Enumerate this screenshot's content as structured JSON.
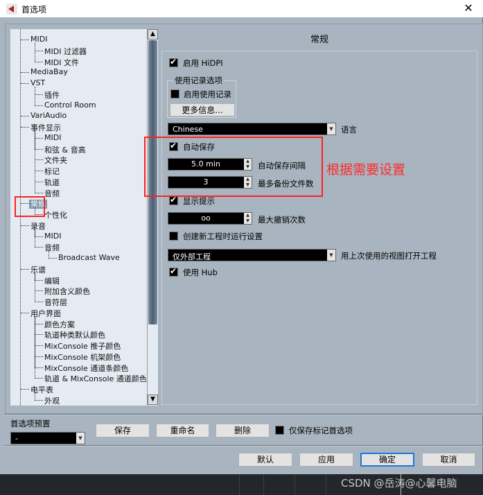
{
  "window": {
    "title": "首选项",
    "close": "✕"
  },
  "tree": {
    "items": [
      {
        "label": "MIDI",
        "level": 1
      },
      {
        "label": "MIDI 过滤器",
        "level": 2
      },
      {
        "label": "MIDI 文件",
        "level": 2
      },
      {
        "label": "MediaBay",
        "level": 1
      },
      {
        "label": "VST",
        "level": 1
      },
      {
        "label": "插件",
        "level": 2
      },
      {
        "label": "Control Room",
        "level": 2
      },
      {
        "label": "VariAudio",
        "level": 1
      },
      {
        "label": "事件显示",
        "level": 1
      },
      {
        "label": "MIDI",
        "level": 2
      },
      {
        "label": "和弦 & 音高",
        "level": 2
      },
      {
        "label": "文件夹",
        "level": 2
      },
      {
        "label": "标记",
        "level": 2
      },
      {
        "label": "轨道",
        "level": 2
      },
      {
        "label": "音频",
        "level": 2
      },
      {
        "label": "常规",
        "level": 1,
        "selected": true
      },
      {
        "label": "个性化",
        "level": 2
      },
      {
        "label": "录音",
        "level": 1
      },
      {
        "label": "MIDI",
        "level": 2
      },
      {
        "label": "音频",
        "level": 2
      },
      {
        "label": "Broadcast Wave",
        "level": 3
      },
      {
        "label": "乐谱",
        "level": 1
      },
      {
        "label": "编辑",
        "level": 2
      },
      {
        "label": "附加含义颜色",
        "level": 2
      },
      {
        "label": "音符层",
        "level": 2
      },
      {
        "label": "用户界面",
        "level": 1
      },
      {
        "label": "颜色方案",
        "level": 2
      },
      {
        "label": "轨道种类默认颜色",
        "level": 2
      },
      {
        "label": "MixConsole 推子颜色",
        "level": 2
      },
      {
        "label": "MixConsole 机架颜色",
        "level": 2
      },
      {
        "label": "MixConsole 通道条颜色",
        "level": 2
      },
      {
        "label": "轨道 & MixConsole 通道颜色",
        "level": 2
      },
      {
        "label": "电平表",
        "level": 1
      },
      {
        "label": "外观",
        "level": 2
      }
    ]
  },
  "panel": {
    "title": "常规",
    "hidpi": {
      "label": "启用 HiDPI",
      "checked": true
    },
    "usage_group": {
      "title": "使用记录选项",
      "enable_label": "启用使用记录",
      "enable_checked": false,
      "more_info": "更多信息..."
    },
    "language": {
      "value": "Chinese",
      "label": "语言"
    },
    "autosave": {
      "label": "自动保存",
      "checked": true
    },
    "autosave_interval": {
      "value": "5.0 min",
      "label": "自动保存间隔"
    },
    "max_backups": {
      "value": "3",
      "label": "最多备份文件数"
    },
    "show_tips": {
      "label": "显示提示",
      "checked": true
    },
    "max_undo": {
      "value": "oo",
      "label": "最大撤销次数"
    },
    "run_setup": {
      "label": "创建新工程时运行设置",
      "checked": false
    },
    "open_view": {
      "value": "仅外部工程",
      "label": "用上次使用的视图打开工程"
    },
    "use_hub": {
      "label": "使用 Hub",
      "checked": true
    }
  },
  "annotation": {
    "text": "根据需要设置",
    "color": "#ff2b2b"
  },
  "presets": {
    "label": "首选项预置",
    "value": "-",
    "save": "保存",
    "rename": "重命名",
    "delete": "删除",
    "only_marked_label": "仅保存标记首选项",
    "only_marked_checked": false
  },
  "footer": {
    "default": "默认",
    "apply": "应用",
    "ok": "确定",
    "cancel": "取消"
  },
  "watermark": "CSDN @岳涛@心馨电脑"
}
